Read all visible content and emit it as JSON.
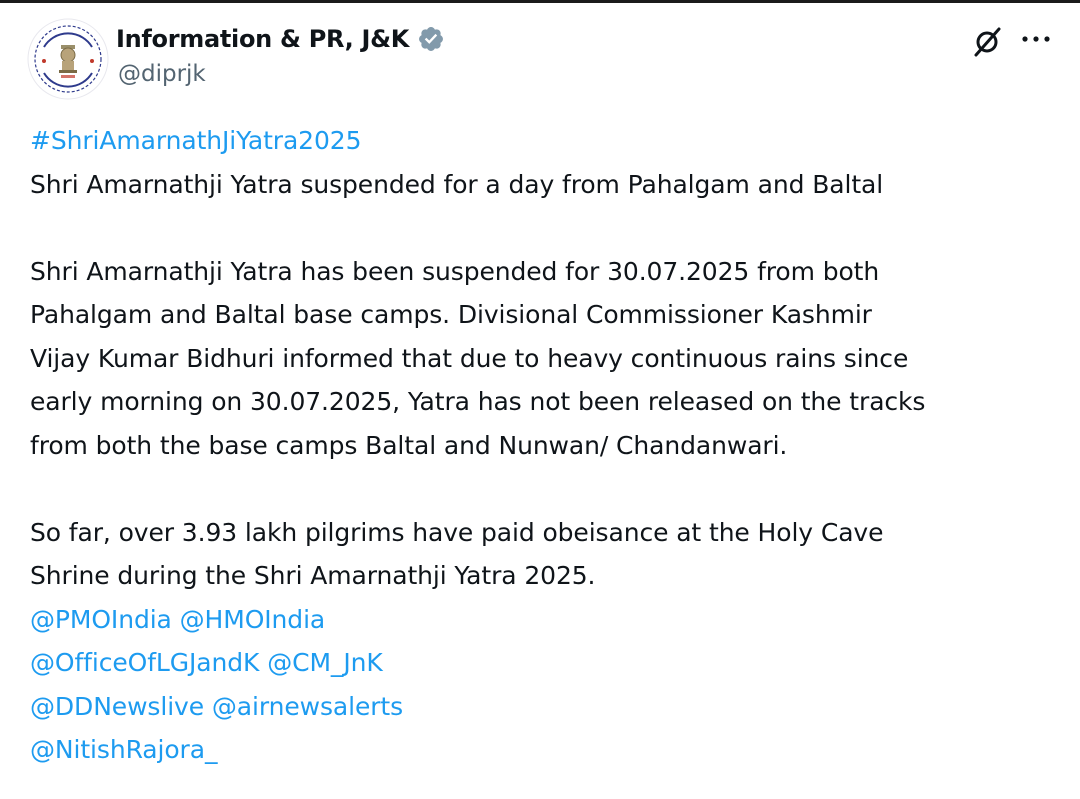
{
  "author": {
    "display_name": "Information & PR, J&K",
    "handle": "@diprjk",
    "avatar_icon": "emblem-seal-logo",
    "verified_icon": "verified-badge-icon"
  },
  "actions": {
    "grok_icon": "grok-icon",
    "more_icon": "more-options-icon"
  },
  "tweet": {
    "hashtag": "#ShriAmarnathJiYatra2025",
    "headline": "Shri Amarnathji Yatra suspended for a day from Pahalgam and Baltal",
    "paragraph1_lines": [
      "Shri Amarnathji Yatra has been suspended for 30.07.2025 from both",
      "Pahalgam and Baltal base camps. Divisional Commissioner Kashmir",
      "Vijay Kumar Bidhuri informed that due to heavy continuous rains since",
      "early morning on 30.07.2025, Yatra has not been released on the tracks",
      "from both the base camps Baltal and Nunwan/ Chandanwari."
    ],
    "paragraph2_lines": [
      "So far, over 3.93 lakh pilgrims have paid obeisance at the Holy Cave",
      "Shrine during the Shri Amarnathji Yatra 2025."
    ],
    "mentions": {
      "pmo": "@PMOIndia",
      "hmo": "@HMOIndia",
      "lg": "@OfficeOfLGJandK",
      "cm": "@CM_JnK",
      "dd": "@DDNewslive",
      "air": "@airnewsalerts",
      "nitish": "@NitishRajora_"
    }
  },
  "colors": {
    "link": "#1d9bf0",
    "text": "#0f1419",
    "secondary_text": "#536471",
    "verified_badge": "#829aab"
  }
}
